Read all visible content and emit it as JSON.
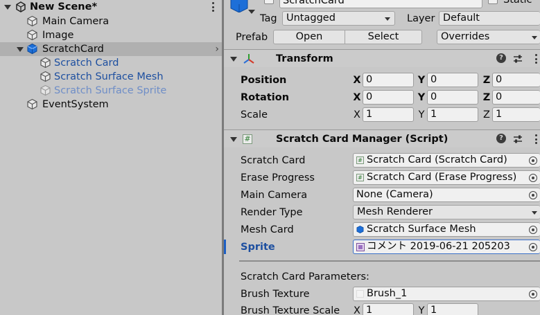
{
  "hierarchy": {
    "scene_name": "New Scene*",
    "items": [
      {
        "label": "Main Camera"
      },
      {
        "label": "Image"
      },
      {
        "label": "ScratchCard"
      },
      {
        "label": "Scratch Card"
      },
      {
        "label": "Scratch Surface Mesh"
      },
      {
        "label": "Scratch Surface Sprite"
      },
      {
        "label": "EventSystem"
      }
    ]
  },
  "inspector": {
    "object_name": "ScratchCard",
    "static_label": "Static",
    "tag_label": "Tag",
    "tag_value": "Untagged",
    "layer_label": "Layer",
    "layer_value": "Default",
    "prefab_label": "Prefab",
    "prefab_open": "Open",
    "prefab_select": "Select",
    "prefab_overrides": "Overrides",
    "transform": {
      "title": "Transform",
      "rows": [
        {
          "label": "Position",
          "x": "0",
          "y": "0",
          "z": "0"
        },
        {
          "label": "Rotation",
          "x": "0",
          "y": "0",
          "z": "0"
        },
        {
          "label": "Scale",
          "x": "1",
          "y": "1",
          "z": "1"
        }
      ],
      "axis_x": "X",
      "axis_y": "Y",
      "axis_z": "Z"
    },
    "script": {
      "title": "Scratch Card Manager (Script)",
      "fields": {
        "scratch_card_label": "Scratch Card",
        "scratch_card_value": "Scratch Card (Scratch Card)",
        "erase_progress_label": "Erase Progress",
        "erase_progress_value": "Scratch Card (Erase Progress)",
        "main_camera_label": "Main Camera",
        "main_camera_value": "None (Camera)",
        "render_type_label": "Render Type",
        "render_type_value": "Mesh Renderer",
        "mesh_card_label": "Mesh Card",
        "mesh_card_value": "Scratch Surface Mesh",
        "sprite_label": "Sprite",
        "sprite_value": "コメント 2019-06-21 205203"
      },
      "params_header": "Scratch Card Parameters:",
      "brush_texture_label": "Brush Texture",
      "brush_texture_value": "Brush_1",
      "brush_scale_label": "Brush Texture Scale",
      "brush_scale_x": "1",
      "brush_scale_y": "1"
    }
  },
  "colors": {
    "panel_bg": "#c8c8c8",
    "selected_row": "#b0b0b0",
    "child_text": "#1d4fa0",
    "disabled_text": "#6f8ec7",
    "accent_blue": "#1d5fc4"
  }
}
